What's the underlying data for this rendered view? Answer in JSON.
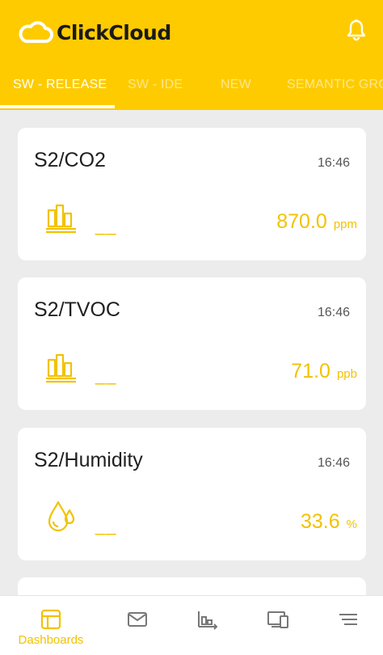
{
  "app": {
    "name": "ClickCloud",
    "brand_color": "#fecb00",
    "accent_color": "#f2c200"
  },
  "header": {
    "logo_icon": "cloud-icon",
    "notification_icon": "bell-icon"
  },
  "tabs": [
    {
      "label": "SW - RELEASE",
      "active": true
    },
    {
      "label": "SW - IDE",
      "active": false
    },
    {
      "label": "NEW",
      "active": false
    },
    {
      "label": "SEMANTIC GRO",
      "active": false
    }
  ],
  "cards": [
    {
      "title": "S2/CO2",
      "time": "16:46",
      "icon": "bar-chart-icon",
      "dash": "__",
      "value": "870.0",
      "unit": "ppm"
    },
    {
      "title": "S2/TVOC",
      "time": "16:46",
      "icon": "bar-chart-icon",
      "dash": "__",
      "value": "71.0",
      "unit": "ppb"
    },
    {
      "title": "S2/Humidity",
      "time": "16:46",
      "icon": "water-drops-icon",
      "dash": "__",
      "value": "33.6",
      "unit": "%"
    }
  ],
  "bottom_nav": [
    {
      "label": "Dashboards",
      "icon": "dashboard-icon",
      "active": true
    },
    {
      "label": "",
      "icon": "mail-icon",
      "active": false
    },
    {
      "label": "",
      "icon": "bar-timeline-icon",
      "active": false
    },
    {
      "label": "",
      "icon": "devices-icon",
      "active": false
    },
    {
      "label": "",
      "icon": "menu-icon",
      "active": false
    }
  ]
}
